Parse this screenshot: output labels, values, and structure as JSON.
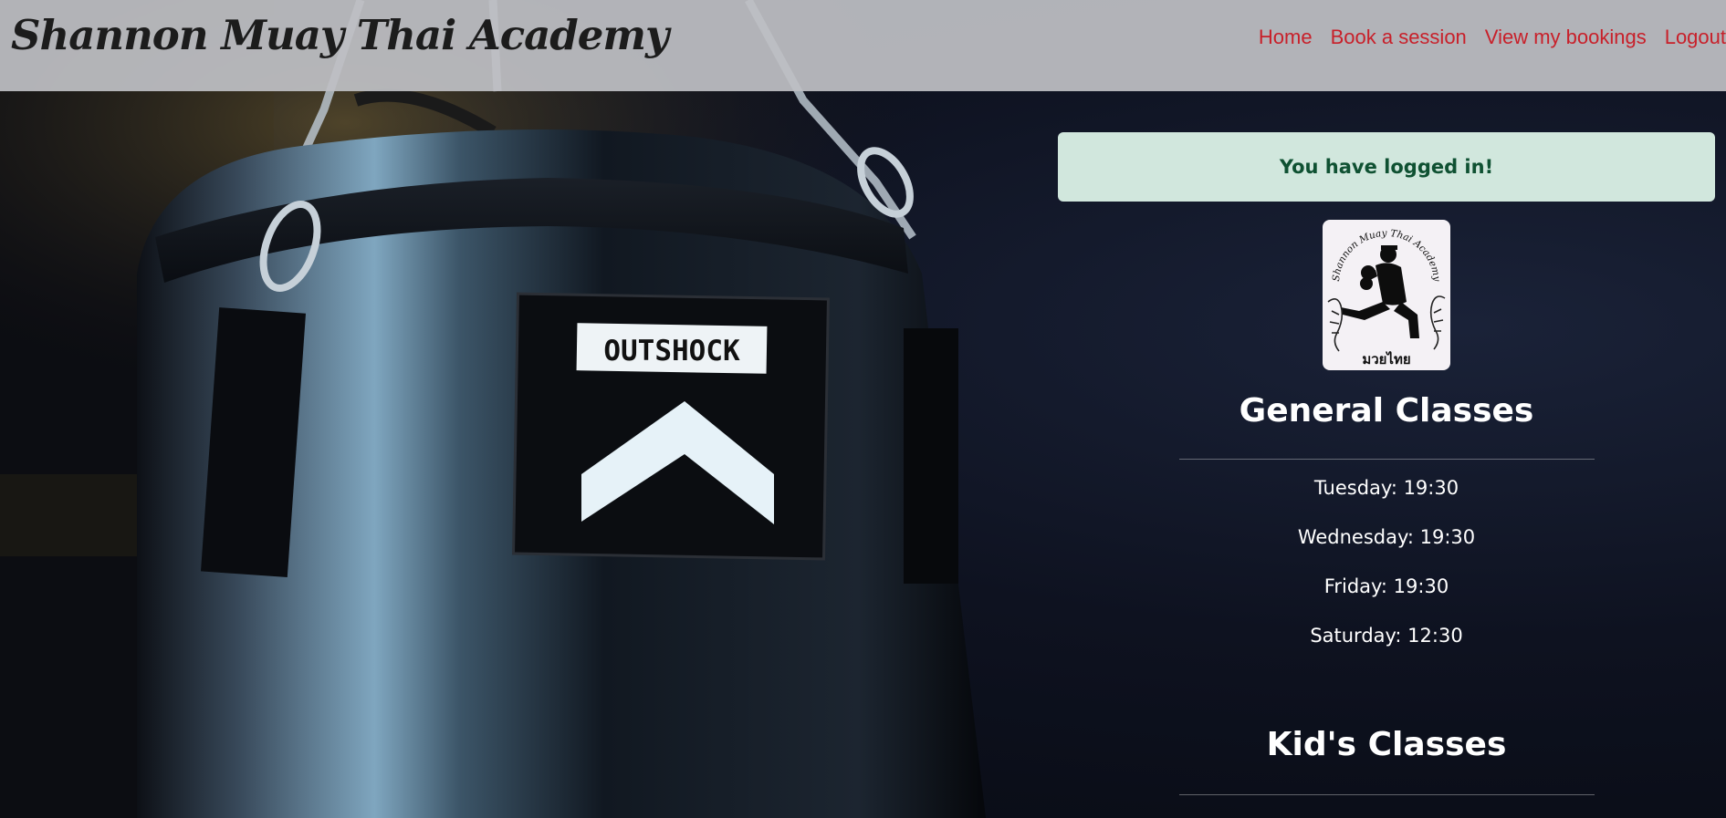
{
  "navbar": {
    "brand": "Shannon Muay Thai Academy",
    "links": [
      {
        "label": "Home"
      },
      {
        "label": "Book a session"
      },
      {
        "label": "View my bookings"
      },
      {
        "label": "Logout"
      }
    ],
    "link_color": "#c8202a"
  },
  "background": {
    "bag_brand": "OUTSHOCK"
  },
  "alert": {
    "message": "You have logged in!",
    "background_color": "#d1e7dd",
    "text_color": "#0f5132"
  },
  "logo": {
    "text_top": "Shannon Muay Thai Academy",
    "text_bottom": "มวยไทย"
  },
  "general_classes": {
    "title": "General Classes",
    "times": [
      "Tuesday: 19:30",
      "Wednesday: 19:30",
      "Friday: 19:30",
      "Saturday: 12:30"
    ]
  },
  "kids_classes": {
    "title": "Kid's Classes"
  }
}
